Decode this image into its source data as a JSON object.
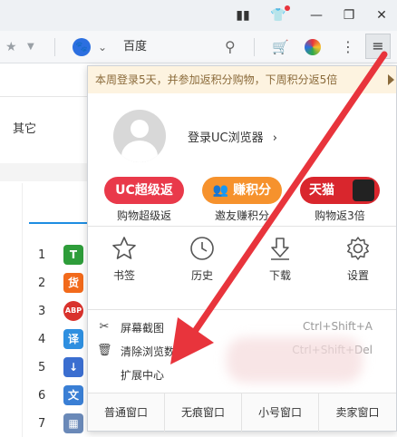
{
  "toolbar": {
    "search_engine": "百度",
    "menu_icon": "hamburger-icon"
  },
  "page": {
    "other_label": "其它",
    "ranks": [
      "1",
      "2",
      "3",
      "4",
      "5",
      "6",
      "7"
    ],
    "app_icons": [
      {
        "glyph": "T",
        "color": "#2e9d3a"
      },
      {
        "glyph": "货",
        "color": "#f26a1b"
      },
      {
        "glyph": "ABP",
        "color": "#d9322c"
      },
      {
        "glyph": "译",
        "color": "#2e8fe0"
      },
      {
        "glyph": "↓",
        "color": "#3b6ed0"
      },
      {
        "glyph": "文",
        "color": "#3a7fd5"
      },
      {
        "glyph": "▦",
        "color": "#6a89b8"
      }
    ]
  },
  "menu": {
    "notice": "本周登录5天，并参加返积分购物，下周积分返5倍",
    "login": "登录UC浏览器",
    "promos": [
      {
        "label": "UC超级返",
        "caption": "购物超级返",
        "color": "#e9394a"
      },
      {
        "label": "赚积分",
        "caption": "邀友赚积分",
        "color": "#f6922d"
      },
      {
        "label": "天猫",
        "caption": "购物返3倍",
        "color": "#d9262d"
      }
    ],
    "tools": [
      {
        "label": "书签",
        "icon": "star-icon"
      },
      {
        "label": "历史",
        "icon": "clock-icon"
      },
      {
        "label": "下载",
        "icon": "download-icon"
      },
      {
        "label": "设置",
        "icon": "gear-icon"
      }
    ],
    "items": [
      {
        "label": "屏幕截图",
        "shortcut": "Ctrl+Shift+A",
        "icon": "scissors-icon"
      },
      {
        "label": "清除浏览数据",
        "shortcut": "Ctrl+Shift+Del",
        "icon": "trash-icon"
      },
      {
        "label": "扩展中心",
        "shortcut": "",
        "icon": "puzzle-icon"
      }
    ],
    "windows": [
      "普通窗口",
      "无痕窗口",
      "小号窗口",
      "卖家窗口"
    ]
  },
  "colors": {
    "accent_red": "#e8343c",
    "notice_bg": "#fdf3e0"
  }
}
